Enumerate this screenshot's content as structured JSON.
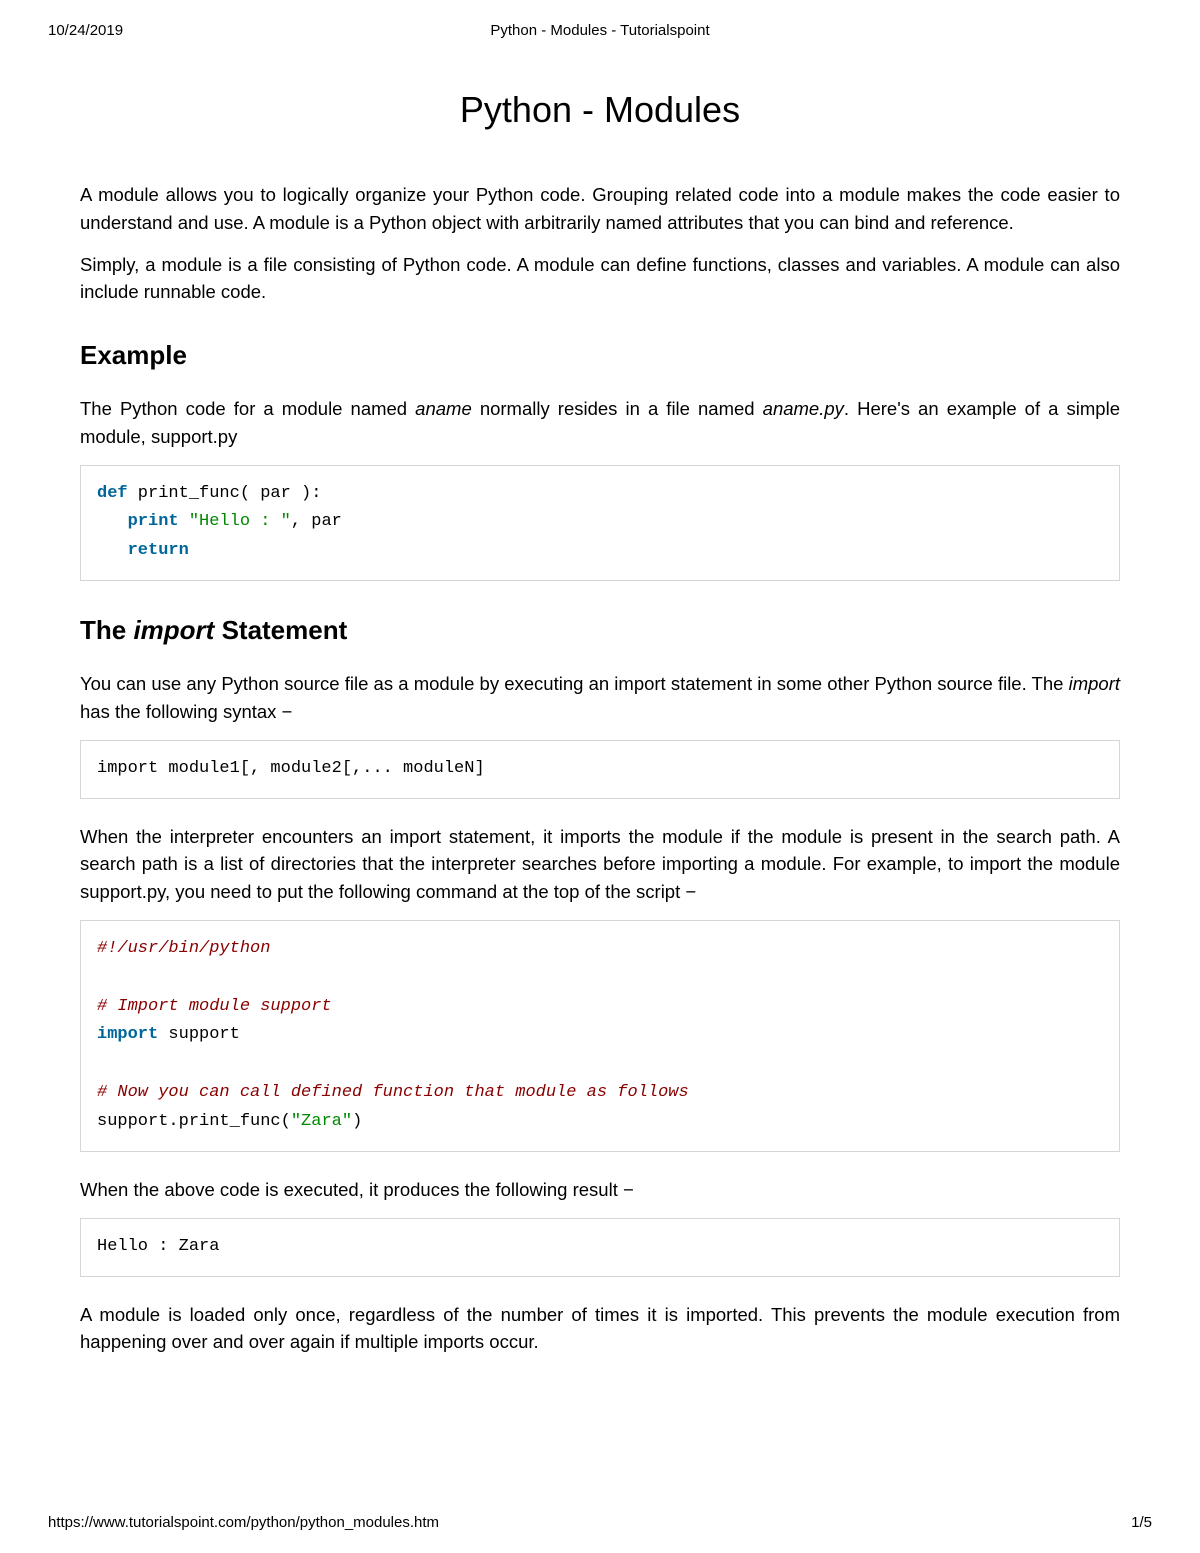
{
  "header": {
    "date": "10/24/2019",
    "title": "Python - Modules - Tutorialspoint"
  },
  "page_title": "Python - Modules",
  "paragraphs": {
    "intro1": "A module allows you to logically organize your Python code. Grouping related code into a module makes the code easier to understand and use. A module is a Python object with arbitrarily named attributes that you can bind and reference.",
    "intro2": "Simply, a module is a file consisting of Python code. A module can define functions, classes and variables. A module can also include runnable code.",
    "example_pre": "The Python code for a module named ",
    "example_em1": "aname",
    "example_mid": " normally resides in a file named ",
    "example_em2": "aname.py",
    "example_post": ". Here's an example of a simple module, support.py",
    "import_p1_pre": "You can use any Python source file as a module by executing an import statement in some other Python source file. The ",
    "import_em": "import",
    "import_p1_post": " has the following syntax −",
    "import_p2": "When the interpreter encounters an import statement, it imports the module if the module is present in the search path. A search path is a list of directories that the interpreter searches before importing a module. For example, to import the module support.py, you need to put the following command at the top of the script −",
    "import_p3": "When the above code is executed, it produces the following result −",
    "import_p4": "A module is loaded only once, regardless of the number of times it is imported. This prevents the module execution from happening over and over again if multiple imports occur."
  },
  "headings": {
    "example": "Example",
    "import_pre": "The ",
    "import_em": "import",
    "import_post": " Statement"
  },
  "code_blocks": {
    "block1": {
      "l1_kw": "def",
      "l1_rest": " print_func( par ):",
      "l2_indent": "   ",
      "l2_kw": "print",
      "l2_mid": " ",
      "l2_str": "\"Hello : \"",
      "l2_rest": ", par",
      "l3_indent": "   ",
      "l3_kw": "return"
    },
    "block2": "import module1[, module2[,... moduleN]",
    "block3": {
      "l1_cmt": "#!/usr/bin/python",
      "l2_blank": "",
      "l3_cmt": "# Import module support",
      "l4_kw": "import",
      "l4_rest": " support",
      "l5_blank": "",
      "l6_cmt": "# Now you can call defined function that module as follows",
      "l7_pre": "support.print_func(",
      "l7_str": "\"Zara\"",
      "l7_post": ")"
    },
    "block4": "Hello : Zara"
  },
  "footer": {
    "url": "https://www.tutorialspoint.com/python/python_modules.htm",
    "page": "1/5"
  }
}
